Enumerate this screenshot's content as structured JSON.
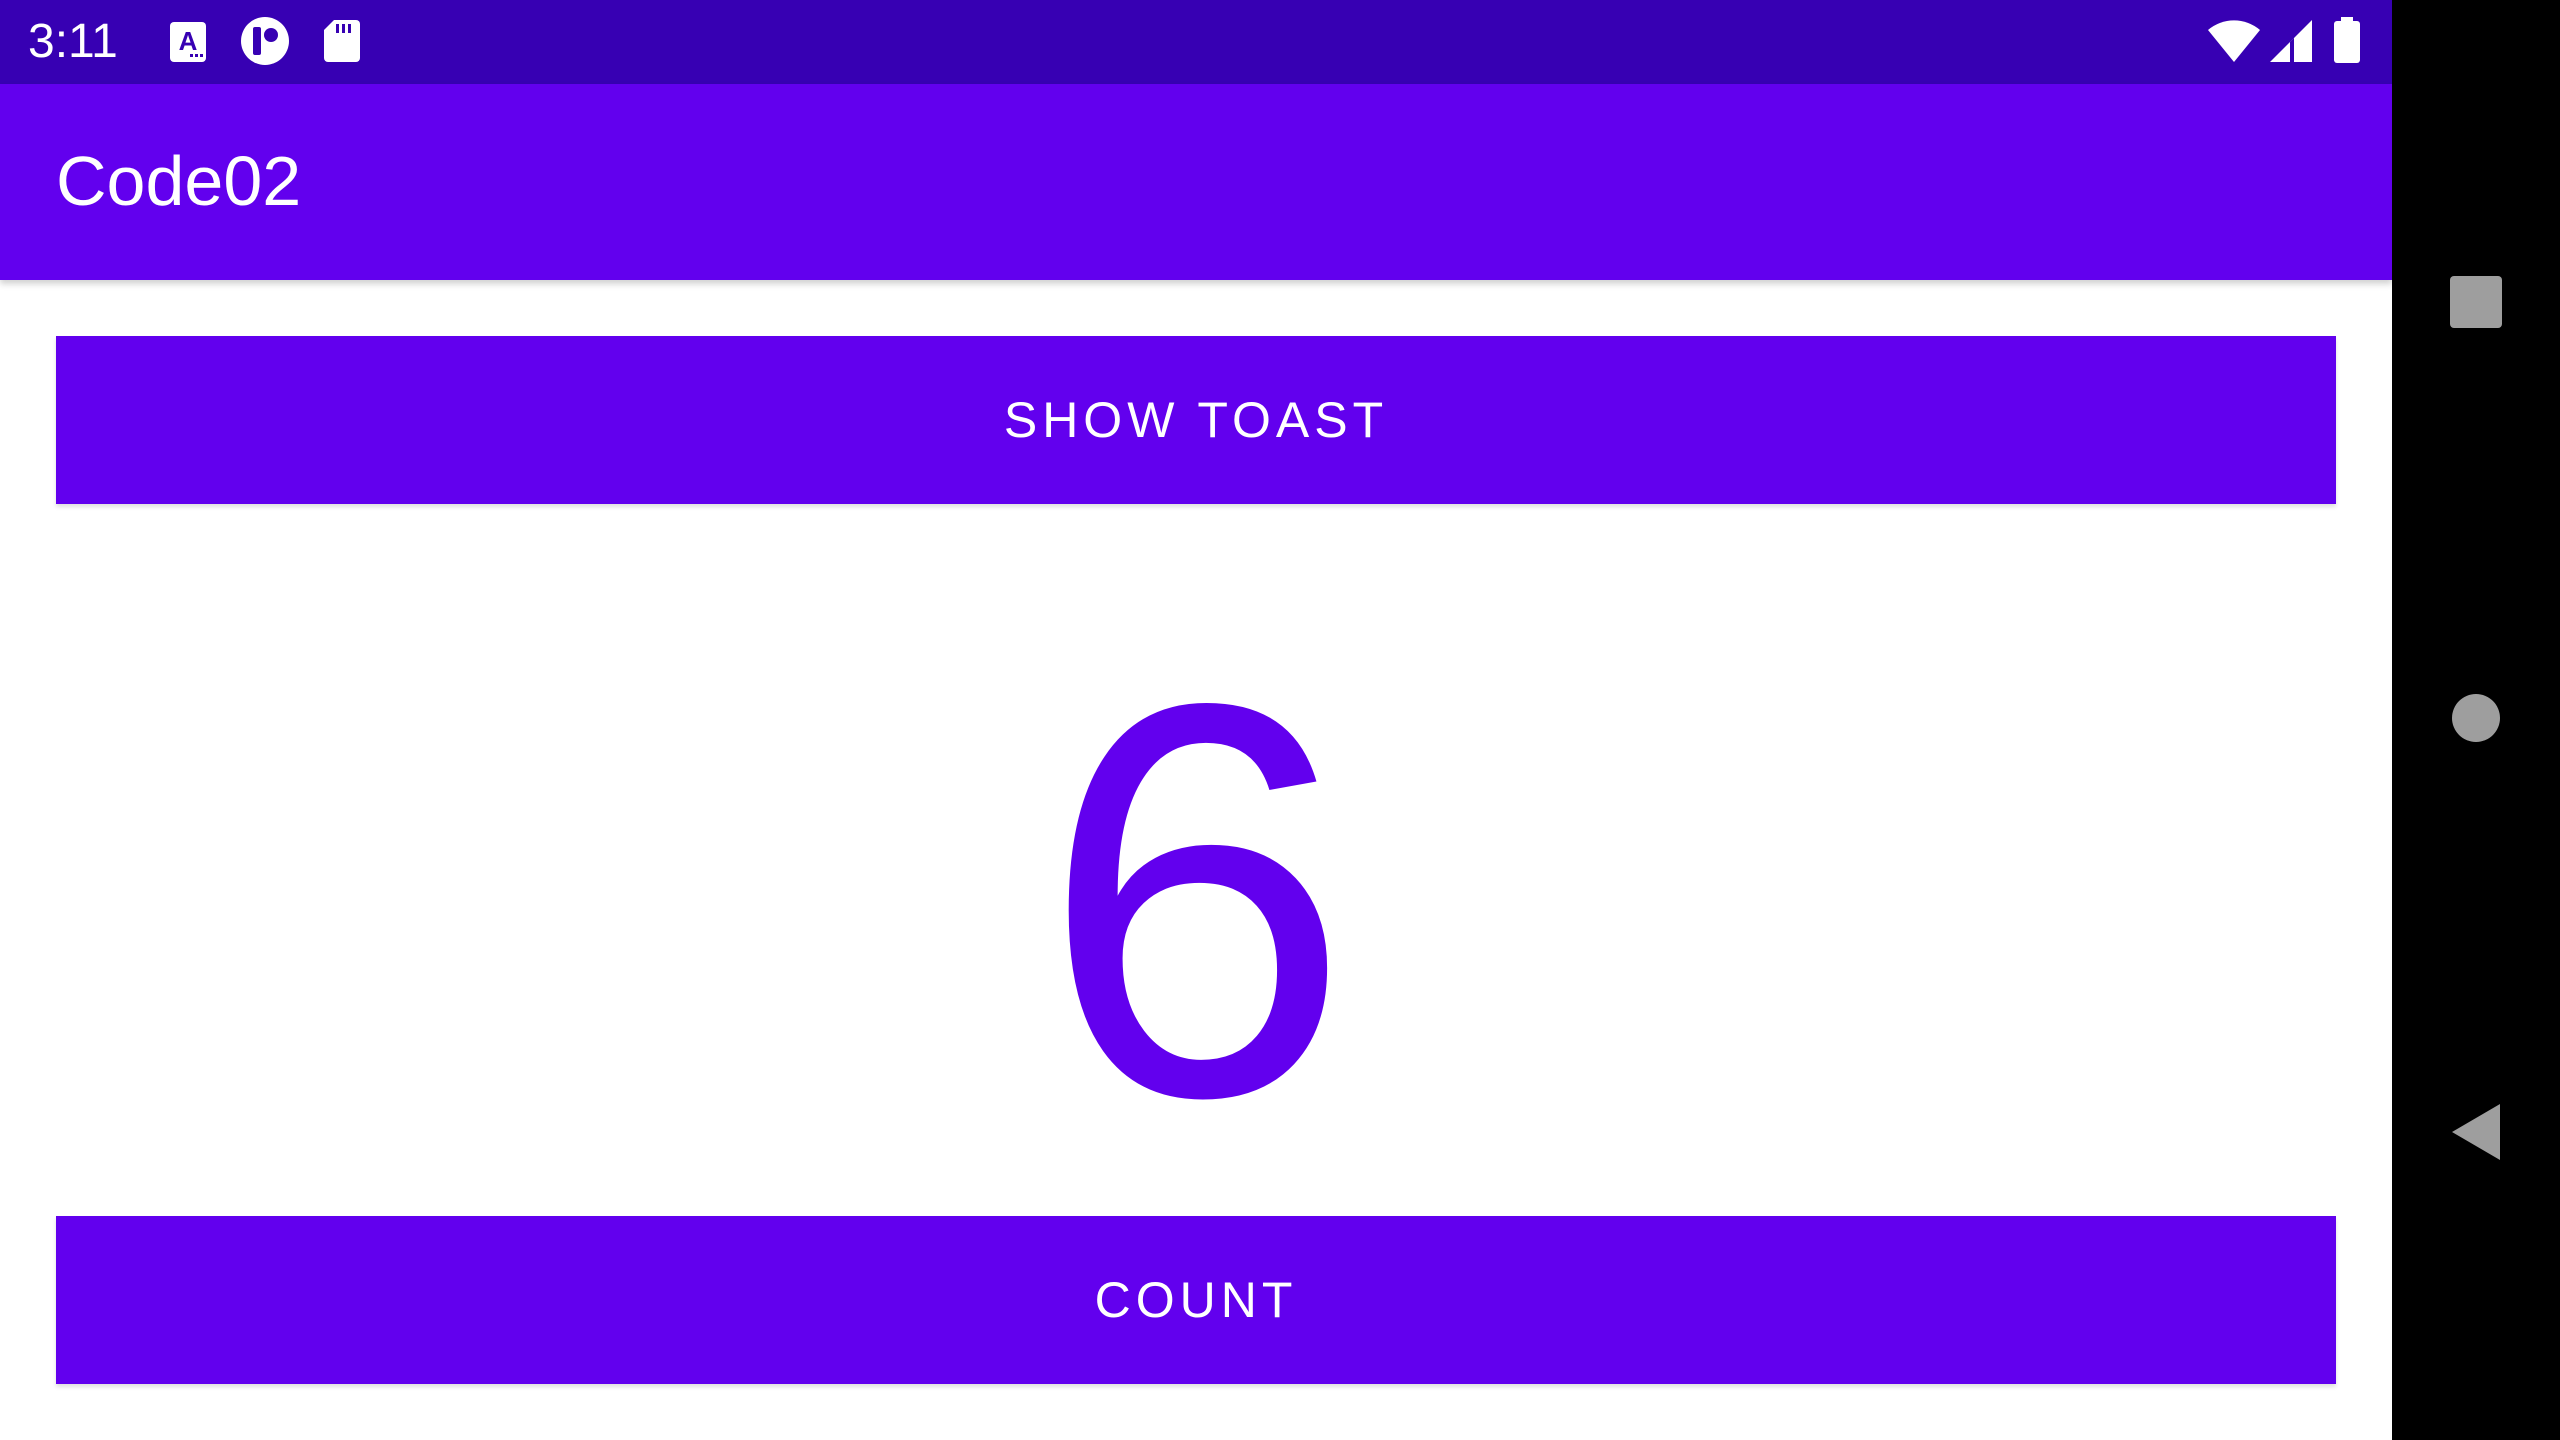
{
  "status_bar": {
    "time": "3:11",
    "left_icons": [
      "text-recognition-icon",
      "app-notification-icon",
      "sd-card-icon"
    ],
    "right_icons": [
      "wifi-icon",
      "cell-signal-icon",
      "battery-icon"
    ]
  },
  "app_bar": {
    "title": "Code02",
    "color": "#6200EE"
  },
  "main": {
    "show_toast_label": "SHOW TOAST",
    "count_value": "6",
    "count_label": "COUNT"
  },
  "nav_bar": {
    "buttons": [
      "recents-square-icon",
      "home-circle-icon",
      "back-triangle-icon"
    ]
  },
  "colors": {
    "primary": "#6200EE",
    "primary_dark": "#3700B3",
    "on_primary": "#FFFFFF",
    "background": "#FFFFFF"
  }
}
